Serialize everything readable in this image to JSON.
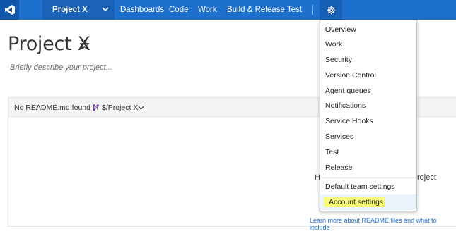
{
  "topbar": {
    "logo_icon": "visual-studio-icon",
    "project_name": "Project X",
    "nav": [
      "Dashboards",
      "Code",
      "Work",
      "Build & Release",
      "Test"
    ],
    "gear_icon": "gear-icon",
    "colors": {
      "bar": "#1e70cd",
      "logo_bg": "#0f56aa"
    }
  },
  "page": {
    "title": "Project X",
    "description_placeholder": "Briefly describe your project..."
  },
  "readme": {
    "status_text": "No README.md found in",
    "repo_path": "$/Project X",
    "body_fragment_left": "H",
    "body_fragment_right": "roject",
    "learn_more": "Learn more about README files and what to include"
  },
  "dropdown": {
    "items": [
      "Overview",
      "Work",
      "Security",
      "Version Control",
      "Agent queues",
      "Notifications",
      "Service Hooks",
      "Services",
      "Test",
      "Release"
    ],
    "extra_items": [
      "Default team settings",
      "Account settings"
    ],
    "highlight_color": "#f6fb7a"
  }
}
